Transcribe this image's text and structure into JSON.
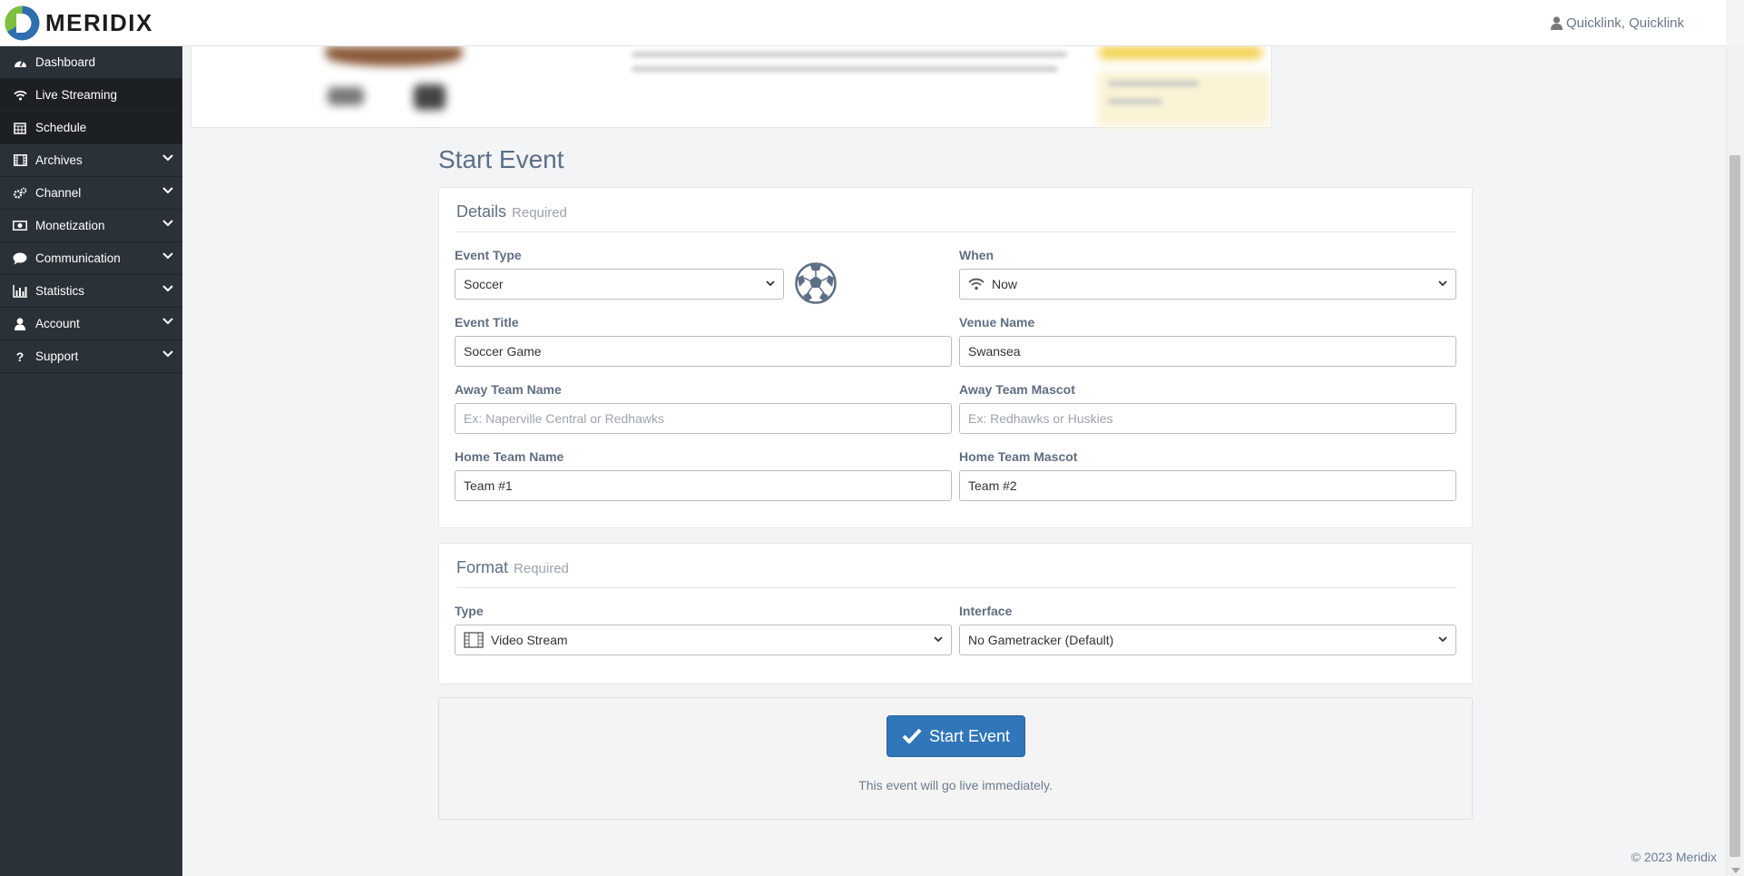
{
  "app": {
    "brand": "MERIDIX",
    "user_label": "Quicklink, Quicklink"
  },
  "sidebar": {
    "items": [
      {
        "label": "Dashboard",
        "icon": "dashboard-icon",
        "expandable": false
      },
      {
        "label": "Live Streaming",
        "icon": "wifi-icon",
        "expandable": false,
        "active": true
      },
      {
        "label": "Schedule",
        "icon": "calendar-icon",
        "expandable": false
      },
      {
        "label": "Archives",
        "icon": "film-icon",
        "expandable": true
      },
      {
        "label": "Channel",
        "icon": "gears-icon",
        "expandable": true
      },
      {
        "label": "Monetization",
        "icon": "money-icon",
        "expandable": true
      },
      {
        "label": "Communication",
        "icon": "comment-icon",
        "expandable": true
      },
      {
        "label": "Statistics",
        "icon": "bar-chart-icon",
        "expandable": true
      },
      {
        "label": "Account",
        "icon": "user-icon",
        "expandable": true
      },
      {
        "label": "Support",
        "icon": "question-icon",
        "expandable": true
      }
    ]
  },
  "page": {
    "title": "Start Event"
  },
  "details": {
    "title": "Details",
    "required": "Required",
    "event_type": {
      "label": "Event Type",
      "value": "Soccer",
      "icon": "soccer-ball-icon"
    },
    "when": {
      "label": "When",
      "value": "Now",
      "icon": "wifi-icon"
    },
    "event_title": {
      "label": "Event Title",
      "value": "Soccer Game"
    },
    "venue_name": {
      "label": "Venue Name",
      "value": "Swansea"
    },
    "away_team_name": {
      "label": "Away Team Name",
      "value": "",
      "placeholder": "Ex: Naperville Central or Redhawks"
    },
    "away_team_mascot": {
      "label": "Away Team Mascot",
      "value": "",
      "placeholder": "Ex: Redhawks or Huskies"
    },
    "home_team_name": {
      "label": "Home Team Name",
      "value": "Team #1"
    },
    "home_team_mascot": {
      "label": "Home Team Mascot",
      "value": "Team #2"
    }
  },
  "format": {
    "title": "Format",
    "required": "Required",
    "type": {
      "label": "Type",
      "value": "Video Stream",
      "icon": "film-icon"
    },
    "interface": {
      "label": "Interface",
      "value": "No Gametracker (Default)"
    }
  },
  "actions": {
    "start_label": "Start Event",
    "hint": "This event will go live immediately."
  },
  "footer": {
    "copyright": "© 2023 Meridix"
  },
  "colors": {
    "primary": "#3076b8",
    "sidebar": "#2b3138",
    "heading": "#5c6f86"
  }
}
